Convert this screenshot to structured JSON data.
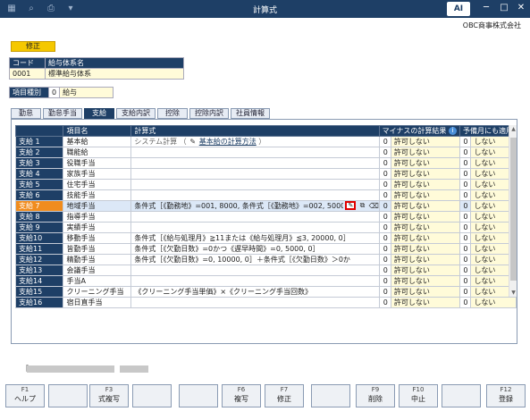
{
  "window": {
    "title": "計算式"
  },
  "header": {
    "company": "OBC商事株式会社",
    "mode": "修正"
  },
  "system": {
    "code_label": "コード",
    "name_label": "給与体系名",
    "code": "0001",
    "name": "標準給与体系"
  },
  "item_type": {
    "label": "項目種別",
    "code": "0",
    "name": "給与"
  },
  "tabs": [
    "勤怠",
    "勤怠手当",
    "支給",
    "支給内訳",
    "控除",
    "控除内訳",
    "社員情報"
  ],
  "columns": {
    "name": "項目名",
    "formula": "計算式",
    "minus": "マイナスの計算結果",
    "spare": "予備月にも適用"
  },
  "formula_link": "基本給の計算方法",
  "rows": [
    {
      "id": "支給 1",
      "name": "基本給",
      "formula": "システム計算 （",
      "minus_code": "0",
      "minus_text": "許可しない",
      "spare_code": "0",
      "spare_text": "しない"
    },
    {
      "id": "支給 2",
      "name": "職能給",
      "formula": "",
      "minus_code": "0",
      "minus_text": "許可しない",
      "spare_code": "0",
      "spare_text": "しない"
    },
    {
      "id": "支給 3",
      "name": "役職手当",
      "formula": "",
      "minus_code": "0",
      "minus_text": "許可しない",
      "spare_code": "0",
      "spare_text": "しない"
    },
    {
      "id": "支給 4",
      "name": "家族手当",
      "formula": "",
      "minus_code": "0",
      "minus_text": "許可しない",
      "spare_code": "0",
      "spare_text": "しない"
    },
    {
      "id": "支給 5",
      "name": "住宅手当",
      "formula": "",
      "minus_code": "0",
      "minus_text": "許可しない",
      "spare_code": "0",
      "spare_text": "しない"
    },
    {
      "id": "支給 6",
      "name": "技能手当",
      "formula": "",
      "minus_code": "0",
      "minus_text": "許可しない",
      "spare_code": "0",
      "spare_text": "しない"
    },
    {
      "id": "支給 7",
      "name": "地域手当",
      "formula": "条件式［《勤務地》=001, 8000, 条件式［《勤務地》=002, 5000",
      "minus_code": "0",
      "minus_text": "許可しない",
      "spare_code": "0",
      "spare_text": "しない"
    },
    {
      "id": "支給 8",
      "name": "指導手当",
      "formula": "",
      "minus_code": "0",
      "minus_text": "許可しない",
      "spare_code": "0",
      "spare_text": "しない"
    },
    {
      "id": "支給 9",
      "name": "実績手当",
      "formula": "",
      "minus_code": "0",
      "minus_text": "許可しない",
      "spare_code": "0",
      "spare_text": "しない"
    },
    {
      "id": "支給10",
      "name": "移動手当",
      "formula": "条件式［《給与処理月》≧11または《給与処理月》≦3, 20000, 0］",
      "minus_code": "0",
      "minus_text": "許可しない",
      "spare_code": "0",
      "spare_text": "しない"
    },
    {
      "id": "支給11",
      "name": "皆勤手当",
      "formula": "条件式［《欠勤日数》=0かつ《遅早時間》=0, 5000, 0］",
      "minus_code": "0",
      "minus_text": "許可しない",
      "spare_code": "0",
      "spare_text": "しない"
    },
    {
      "id": "支給12",
      "name": "精勤手当",
      "formula": "条件式［《欠勤日数》=0, 10000, 0］＋条件式［《欠勤日数》＞0か",
      "minus_code": "0",
      "minus_text": "許可しない",
      "spare_code": "0",
      "spare_text": "しない"
    },
    {
      "id": "支給13",
      "name": "会議手当",
      "formula": "",
      "minus_code": "0",
      "minus_text": "許可しない",
      "spare_code": "0",
      "spare_text": "しない"
    },
    {
      "id": "支給14",
      "name": "手当A",
      "formula": "",
      "minus_code": "0",
      "minus_text": "許可しない",
      "spare_code": "0",
      "spare_text": "しない"
    },
    {
      "id": "支給15",
      "name": "クリーニング手当",
      "formula": "《クリーニング手当単価》×《クリーニング手当回数》",
      "minus_code": "0",
      "minus_text": "許可しない",
      "spare_code": "0",
      "spare_text": "しない"
    },
    {
      "id": "支給16",
      "name": "宿日直手当",
      "formula": "",
      "minus_code": "0",
      "minus_text": "許可しない",
      "spare_code": "0",
      "spare_text": "しない"
    }
  ],
  "status_bracket": "［",
  "fkeys": [
    {
      "key": "F1",
      "label": "ヘルプ"
    },
    {
      "key": "",
      "label": ""
    },
    {
      "key": "F3",
      "label": "式複写"
    },
    {
      "key": "",
      "label": ""
    },
    {
      "key": "",
      "label": ""
    },
    {
      "key": "F6",
      "label": "複写"
    },
    {
      "key": "F7",
      "label": "修正"
    },
    {
      "key": "",
      "label": ""
    },
    {
      "key": "F9",
      "label": "削除"
    },
    {
      "key": "F10",
      "label": "中止"
    },
    {
      "key": "",
      "label": ""
    },
    {
      "key": "F12",
      "label": "登録"
    }
  ]
}
